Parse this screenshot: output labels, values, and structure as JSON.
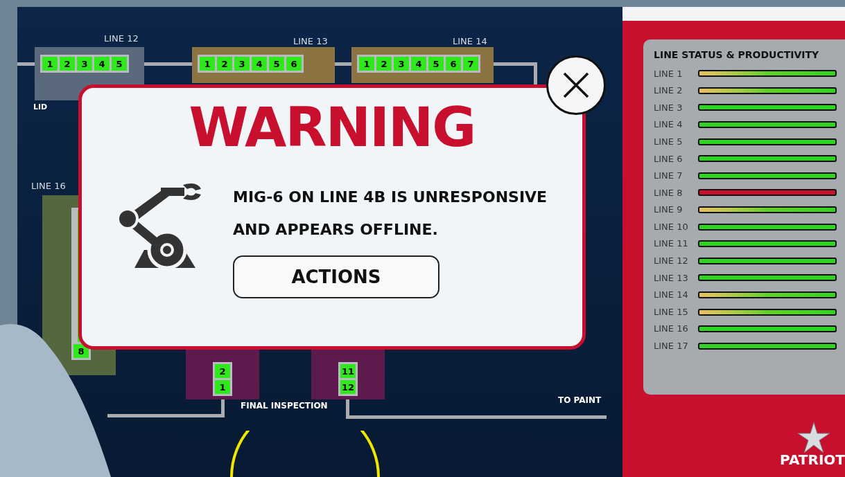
{
  "diagram": {
    "top_lines": [
      {
        "label": "LINE 12",
        "stations": [
          "1",
          "2",
          "3",
          "4",
          "5"
        ]
      },
      {
        "label": "LINE 13",
        "stations": [
          "1",
          "2",
          "3",
          "4",
          "5",
          "6"
        ]
      },
      {
        "label": "LINE 14",
        "stations": [
          "1",
          "2",
          "3",
          "4",
          "5",
          "6",
          "7"
        ]
      }
    ],
    "lid_label": "LID",
    "side_line": {
      "label": "LINE 16",
      "stations": [
        "8"
      ]
    },
    "bottom_groups": [
      {
        "stations": [
          "2",
          "1"
        ]
      },
      {
        "stations": [
          "11",
          "12"
        ]
      }
    ],
    "final_inspection_label": "FINAL INSPECTION",
    "to_paint_label": "TO PAINT"
  },
  "warning_dialog": {
    "title": "WARNING",
    "message_lines": [
      "MIG-6 ON LINE 4B IS UNRESPONSIVE",
      "AND APPEARS OFFLINE."
    ],
    "action_button": "ACTIONS"
  },
  "status_panel": {
    "title": "LINE STATUS & PRODUCTIVITY",
    "lines": [
      {
        "label": "LINE 1",
        "kind": "warning"
      },
      {
        "label": "LINE 2",
        "kind": "warning"
      },
      {
        "label": "LINE 3",
        "kind": "ok"
      },
      {
        "label": "LINE 4",
        "kind": "ok"
      },
      {
        "label": "LINE 5",
        "kind": "ok"
      },
      {
        "label": "LINE 6",
        "kind": "ok"
      },
      {
        "label": "LINE 7",
        "kind": "ok"
      },
      {
        "label": "LINE 8",
        "kind": "fault"
      },
      {
        "label": "LINE 9",
        "kind": "warning"
      },
      {
        "label": "LINE 10",
        "kind": "ok"
      },
      {
        "label": "LINE 11",
        "kind": "ok"
      },
      {
        "label": "LINE 12",
        "kind": "ok"
      },
      {
        "label": "LINE 13",
        "kind": "ok"
      },
      {
        "label": "LINE 14",
        "kind": "warning"
      },
      {
        "label": "LINE 15",
        "kind": "warning"
      },
      {
        "label": "LINE 16",
        "kind": "ok"
      },
      {
        "label": "LINE 17",
        "kind": "ok"
      }
    ]
  },
  "logo": {
    "name": "PATRIOT"
  }
}
